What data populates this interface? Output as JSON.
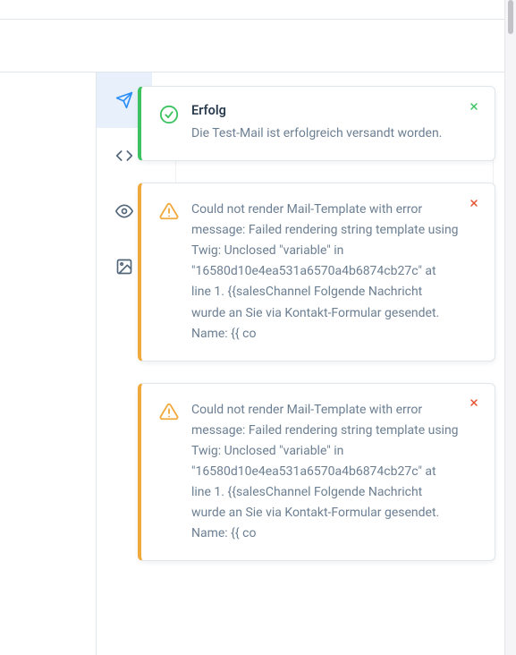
{
  "colors": {
    "success": "#3cc261",
    "warning": "#f0a93d",
    "close_success": "#3cc261",
    "close_warning": "#e5522f",
    "accent_blue": "#2a8ef9"
  },
  "sidebar": {
    "items": [
      {
        "name": "send-icon",
        "active": true
      },
      {
        "name": "code-icon",
        "active": false
      },
      {
        "name": "eye-icon",
        "active": false
      },
      {
        "name": "image-icon",
        "active": false
      }
    ]
  },
  "toasts": [
    {
      "type": "success",
      "title": "Erfolg",
      "message": "Die Test-Mail ist erfolgreich versandt worden."
    },
    {
      "type": "warning",
      "title": "",
      "message": "Could not render Mail-Template with error message: Failed rendering string template using Twig: Unclosed \"variable\" in \"16580d10e4ea531a6570a4b6874cb27c\" at line 1. {{salesChannel Folgende Nachricht wurde an Sie via Kontakt-Formular gesendet. Name: {{ co"
    },
    {
      "type": "warning",
      "title": "",
      "message": "Could not render Mail-Template with error message: Failed rendering string template using Twig: Unclosed \"variable\" in \"16580d10e4ea531a6570a4b6874cb27c\" at line 1. {{salesChannel Folgende Nachricht wurde an Sie via Kontakt-Formular gesendet. Name: {{ co"
    }
  ]
}
